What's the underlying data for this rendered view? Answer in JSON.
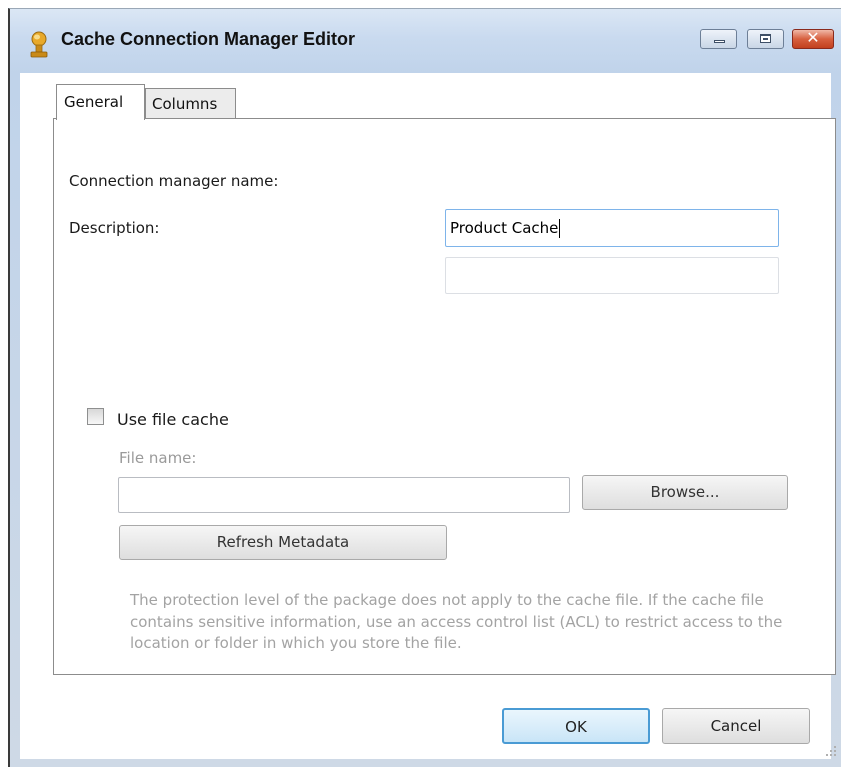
{
  "window": {
    "title": "Cache Connection Manager Editor",
    "controls": [
      "minimize",
      "maximize",
      "close"
    ],
    "close_glyph": "✕"
  },
  "tabs": [
    {
      "label": "General",
      "selected": true
    },
    {
      "label": "Columns",
      "selected": false
    }
  ],
  "general": {
    "connection_name_label": "Connection manager name:",
    "connection_name_value": "Product Cache",
    "description_label": "Description:",
    "description_value": "",
    "use_file_cache_label": "Use file cache",
    "use_file_cache_checked": false,
    "file_name_label": "File name:",
    "file_name_value": "",
    "browse_label": "Browse...",
    "refresh_label": "Refresh Metadata",
    "note": "The protection level of the package does not apply to the cache file. If the cache file contains sensitive information, use an access control list (ACL) to restrict access to the location or folder in which you store the file."
  },
  "footer": {
    "ok_label": "OK",
    "cancel_label": "Cancel"
  },
  "colors": {
    "titlebar": "#c9daef",
    "accent_focus": "#4a9bd4",
    "disabled_text": "#a3a3a3",
    "close_button": "#d7603f"
  },
  "icons": {
    "title_icon": "cache-connection-icon",
    "resize_grip": "size-grip-icon"
  }
}
